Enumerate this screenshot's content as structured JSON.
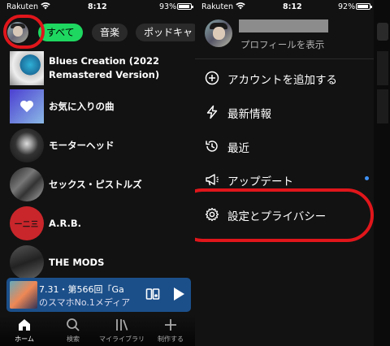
{
  "left": {
    "status": {
      "carrier": "Rakuten",
      "time": "8:12",
      "battery": "93%",
      "battery_level": 0.93
    },
    "chips": [
      "すべて",
      "音楽",
      "ポッドキャ"
    ],
    "library": [
      {
        "title": "Blues Creation (2022 Remastered Version)"
      },
      {
        "title": "お気に入りの曲"
      },
      {
        "title": "モーターヘッド"
      },
      {
        "title": "セックス・ピストルズ"
      },
      {
        "title": "A.R.B."
      },
      {
        "title": "THE MODS"
      }
    ],
    "miniplayer": {
      "title_line": "7.31・第566回「Ga",
      "subtitle_line": "のスマホNo.1メディア"
    },
    "nav": [
      {
        "label": "ホーム",
        "icon": "home-icon"
      },
      {
        "label": "検索",
        "icon": "search-icon"
      },
      {
        "label": "マイライブラリ",
        "icon": "library-icon"
      },
      {
        "label": "制作する",
        "icon": "plus-icon"
      }
    ]
  },
  "right": {
    "status": {
      "carrier": "Rakuten",
      "time": "8:12",
      "battery": "92%",
      "battery_level": 0.92
    },
    "profile_link": "プロフィールを表示",
    "menu": [
      {
        "label": "アカウントを追加する",
        "icon": "add-circle-icon"
      },
      {
        "label": "最新情報",
        "icon": "lightning-icon"
      },
      {
        "label": "最近",
        "icon": "history-icon"
      },
      {
        "label": "アップデート",
        "icon": "megaphone-icon"
      },
      {
        "label": "設定とプライバシー",
        "icon": "gear-icon"
      }
    ],
    "accent_colors": {
      "spotify_green": "#1ed760",
      "annotation_red": "#e0161b",
      "notification_blue": "#3d91f4"
    }
  }
}
